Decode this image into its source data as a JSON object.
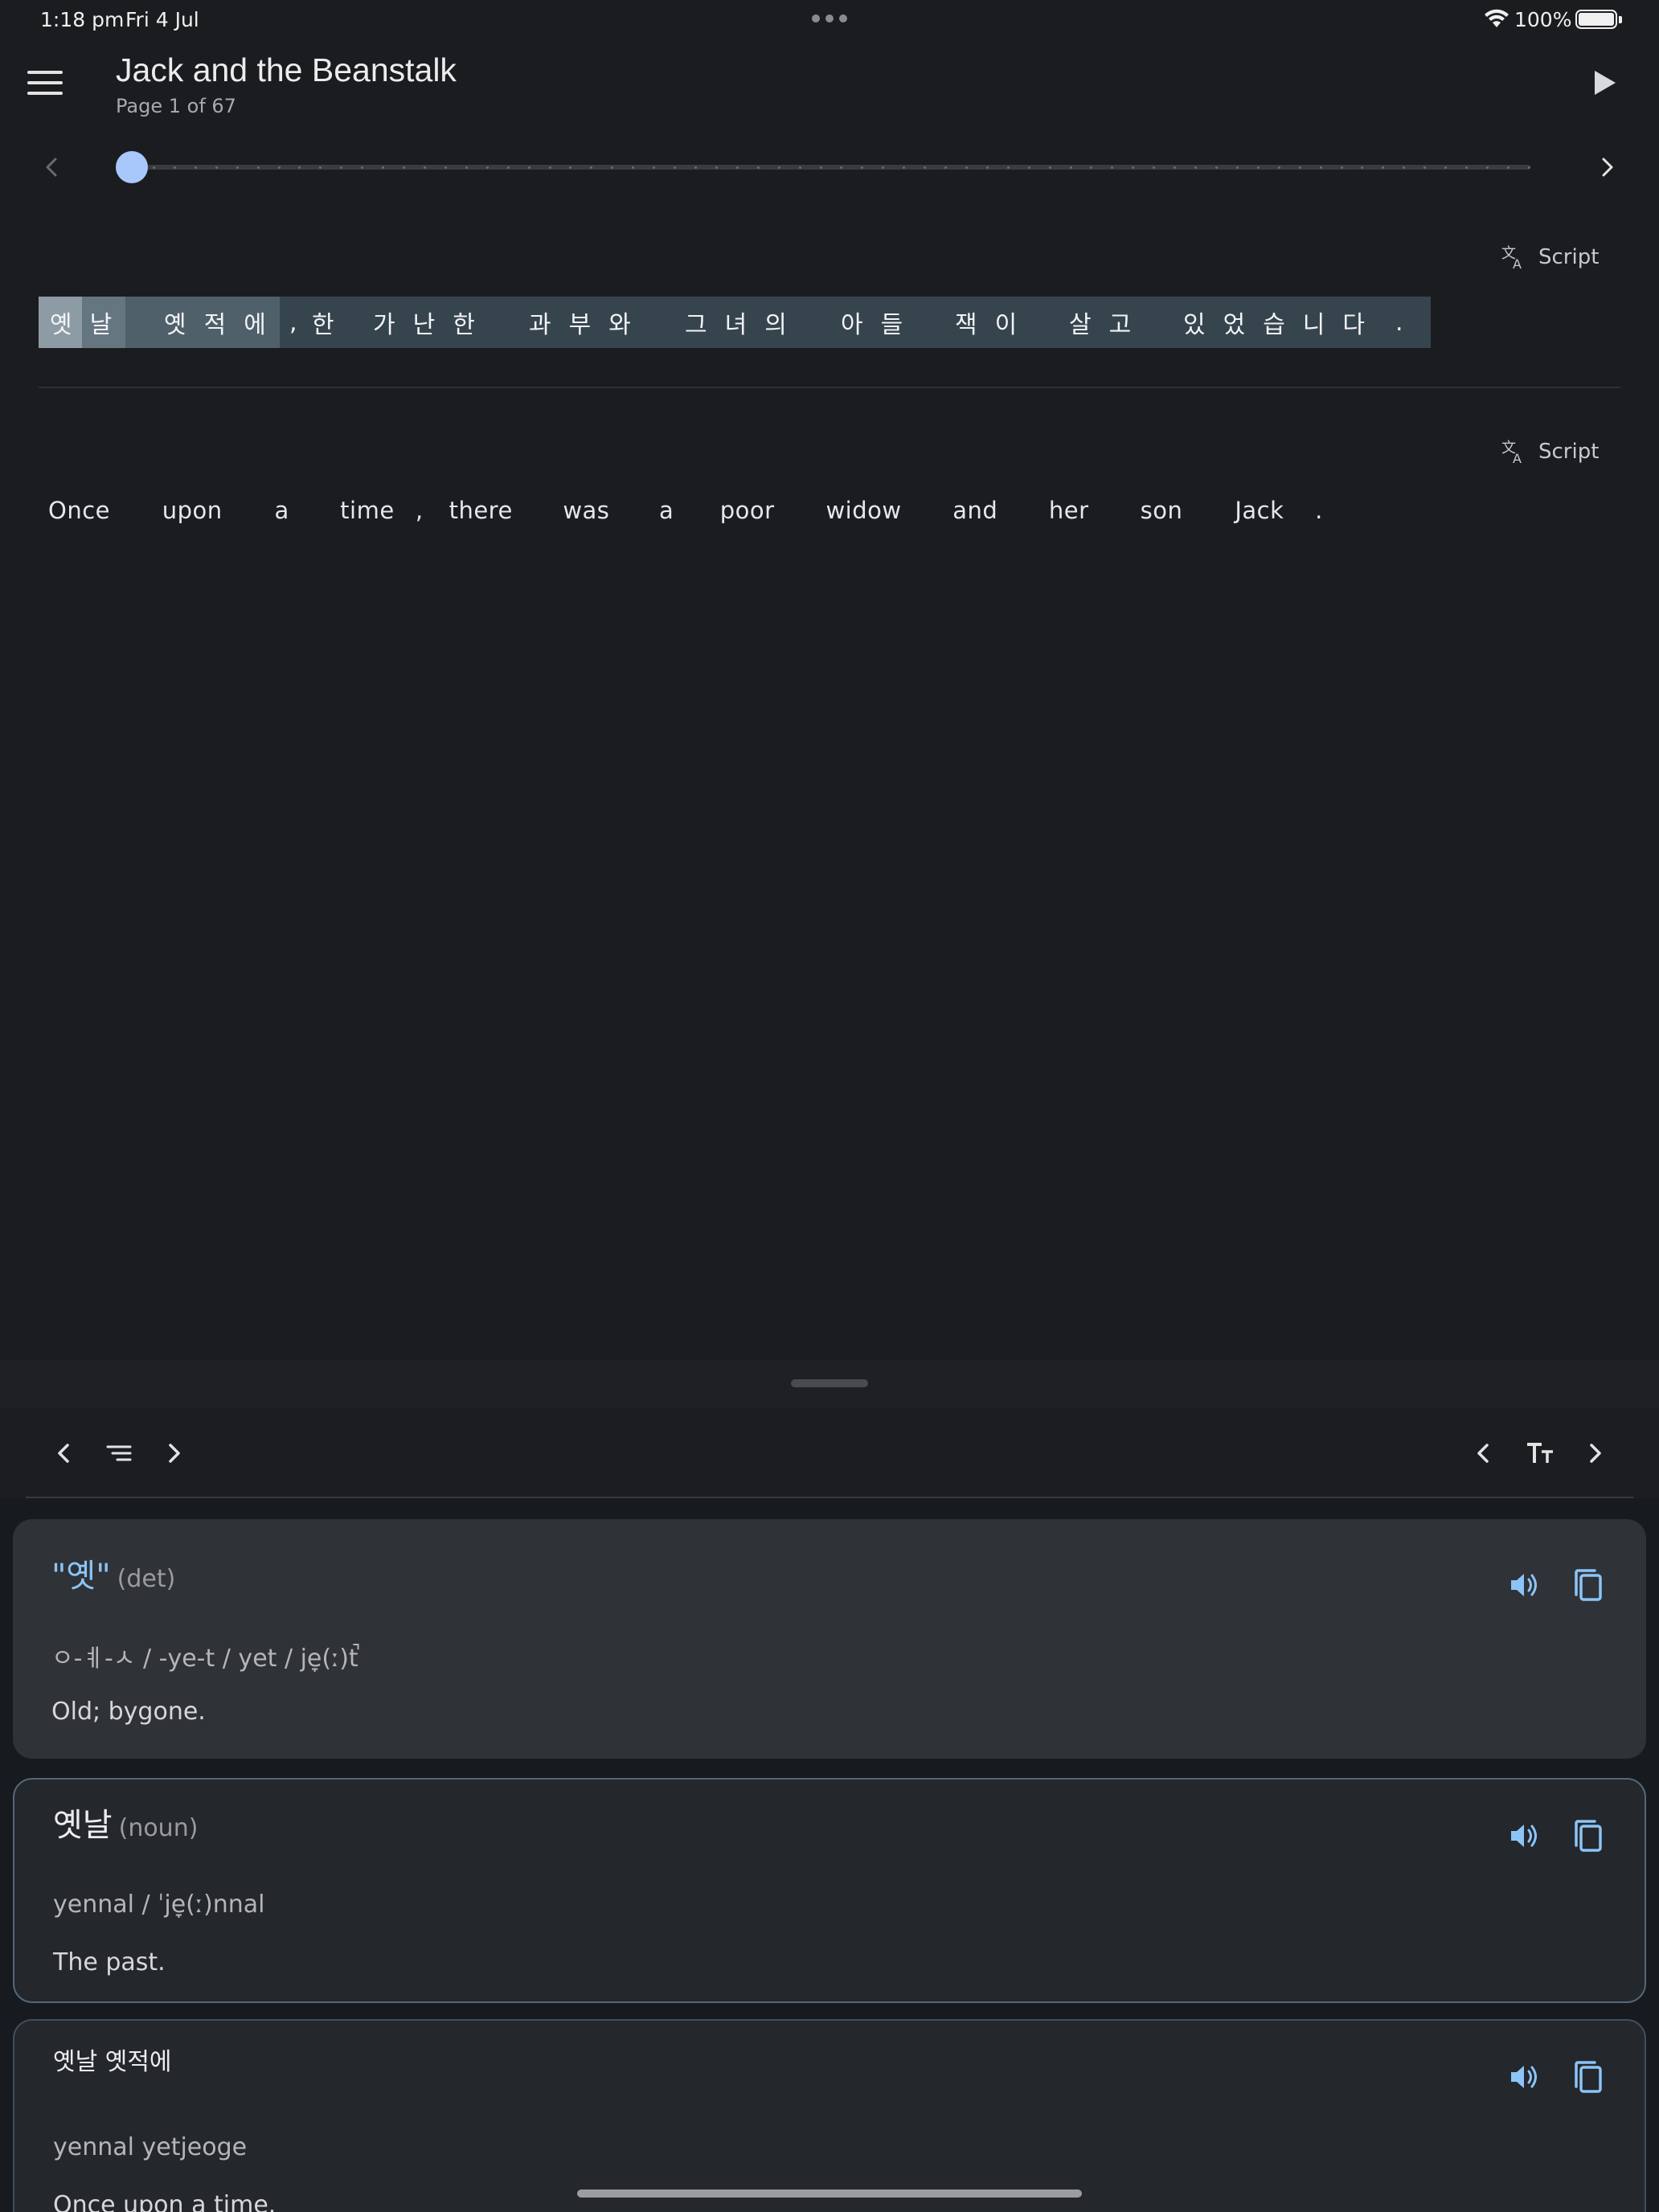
{
  "status_bar": {
    "time": "1:18 pm",
    "date": "Fri 4 Jul",
    "battery": "100%"
  },
  "app_bar": {
    "title": "Jack and the Beanstalk",
    "subtitle": "Page 1 of 67",
    "menu_icon": "hamburger-menu-icon",
    "play_icon": "play-icon"
  },
  "page_slider": {
    "current_page": 1,
    "total_pages": 67
  },
  "original_panel": {
    "script_label": "Script",
    "words": [
      "옛날",
      "옛적에",
      ",",
      "한",
      "가난한",
      "과부와",
      "그녀의",
      "아들",
      "잭이",
      "살고",
      "있었습니다",
      "."
    ],
    "highlighted_words": [
      "옛날",
      "옛적에"
    ],
    "colors": {
      "base": "#36444e",
      "highlight_strong": "#8d9ba5",
      "highlight_mid": "#667681",
      "highlight_soft": "#4f606b"
    }
  },
  "translation_panel": {
    "script_label": "Script",
    "words": [
      "Once",
      "upon",
      "a",
      "time",
      ",",
      "there",
      "was",
      "a",
      "poor",
      "widow",
      "and",
      "her",
      "son",
      "Jack",
      "."
    ]
  },
  "sheet_toolbar": {
    "left_prev_icon": "chevron-left-icon",
    "left_list_icon": "list-icon",
    "left_next_icon": "chevron-right-icon",
    "right_prev_icon": "chevron-left-icon",
    "text_size_icon": "text-size-icon",
    "right_next_icon": "chevron-right-icon"
  },
  "definitions": [
    {
      "word": "\"옛\"",
      "pos": "(det)",
      "phonetic": "ㅇ-ㅖ-ㅅ / -ye-t / yet / je̞(ː)t̚",
      "definition": "Old; bygone.",
      "word_color": "#8cc4f7"
    },
    {
      "word": "옛날",
      "pos": "(noun)",
      "phonetic": "yennal / ˈje̞(ː)nnal",
      "definition": "The past.",
      "word_color": "#ececef"
    },
    {
      "word": "옛날 옛적에",
      "pos": "",
      "phonetic": "yennal yetjeoge",
      "definition": "Once upon a time.",
      "word_color": "#ececef"
    }
  ],
  "accent_color": "#8cc4f7"
}
